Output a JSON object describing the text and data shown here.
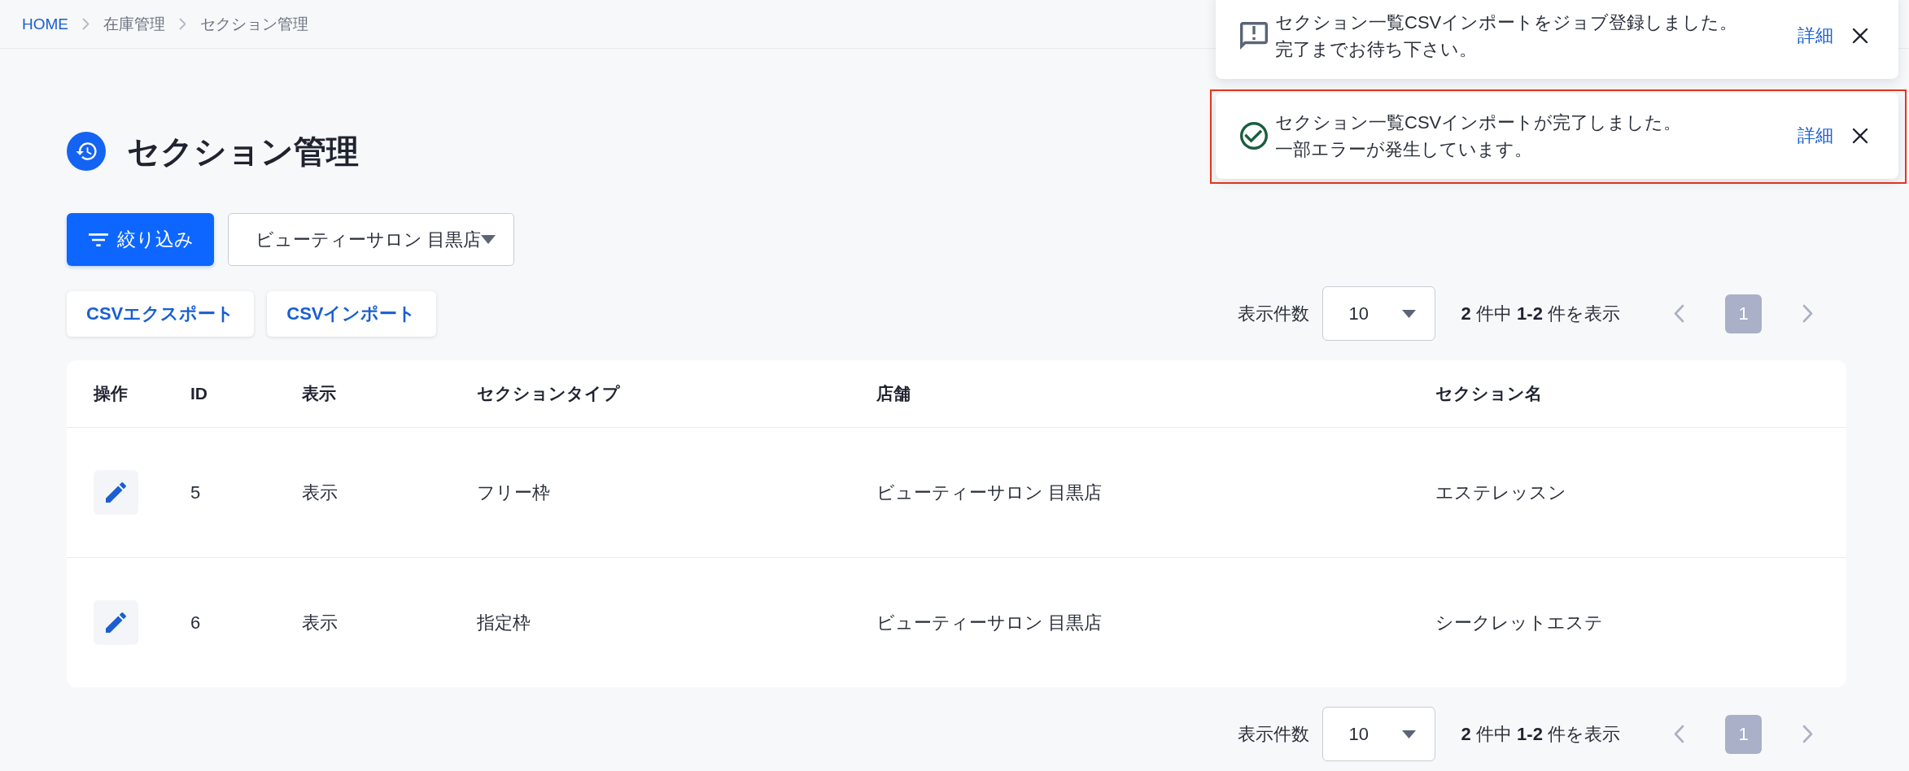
{
  "breadcrumb": [
    {
      "label": "HOME",
      "link": true
    },
    {
      "label": "在庫管理",
      "link": false
    },
    {
      "label": "セクション管理",
      "link": false
    }
  ],
  "notifications": [
    {
      "kind": "info",
      "lines": [
        "セクション一覧CSVインポートをジョブ登録しました。",
        "完了までお待ち下さい。"
      ],
      "link": "詳細",
      "highlighted": false
    },
    {
      "kind": "success",
      "lines": [
        "セクション一覧CSVインポートが完了しました。",
        "一部エラーが発生しています。"
      ],
      "link": "詳細",
      "highlighted": true
    }
  ],
  "page": {
    "title": "セクション管理"
  },
  "filter_button": {
    "label": "絞り込み"
  },
  "store_select": {
    "value": "ビューティーサロン 目黒店"
  },
  "csv_buttons": [
    {
      "label": "CSVエクスポート"
    },
    {
      "label": "CSVインポート"
    }
  ],
  "pagination_top": {
    "label": "表示件数",
    "page_size": "10",
    "summary": "**2** 件中 **1-2** 件を表示",
    "pages": [
      {
        "label": "1",
        "selected": true
      }
    ]
  },
  "table": {
    "columns": [
      "操作",
      "ID",
      "表示",
      "セクションタイプ",
      "店舗",
      "セクション名"
    ],
    "rows": [
      {
        "id": "5",
        "display": "表示",
        "section_type": "フリー枠",
        "store": "ビューティーサロン 目黒店",
        "section_name": "エステレッスン"
      },
      {
        "id": "6",
        "display": "表示",
        "section_type": "指定枠",
        "store": "ビューティーサロン 目黒店",
        "section_name": "シークレットエステ"
      }
    ]
  },
  "pagination_bottom": {
    "label": "表示件数",
    "page_size": "10",
    "summary": "**2** 件中 **1-2** 件を表示",
    "pages": [
      {
        "label": "1",
        "selected": true
      }
    ]
  }
}
